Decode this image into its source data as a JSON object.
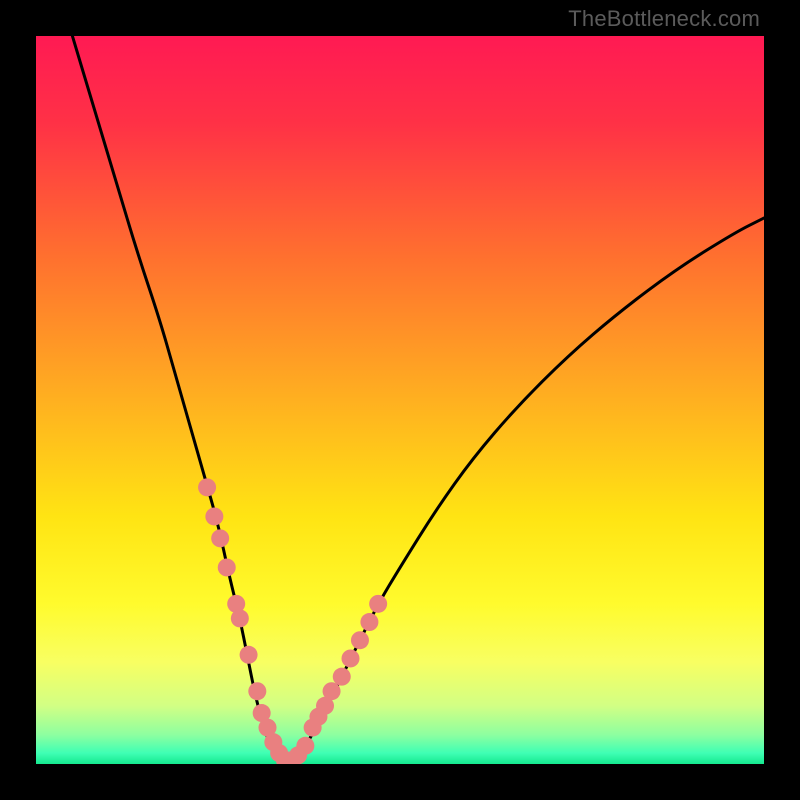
{
  "watermark": "TheBottleneck.com",
  "chart_data": {
    "type": "line",
    "title": "",
    "xlabel": "",
    "ylabel": "",
    "xlim": [
      0,
      100
    ],
    "ylim": [
      0,
      100
    ],
    "background_gradient_stops": [
      {
        "offset": 0.0,
        "color": "#ff1a53"
      },
      {
        "offset": 0.12,
        "color": "#ff3146"
      },
      {
        "offset": 0.3,
        "color": "#ff6f2f"
      },
      {
        "offset": 0.5,
        "color": "#ffb020"
      },
      {
        "offset": 0.66,
        "color": "#ffe413"
      },
      {
        "offset": 0.78,
        "color": "#fffb2d"
      },
      {
        "offset": 0.86,
        "color": "#f8ff62"
      },
      {
        "offset": 0.92,
        "color": "#d2ff84"
      },
      {
        "offset": 0.96,
        "color": "#8dffa0"
      },
      {
        "offset": 0.985,
        "color": "#3fffb4"
      },
      {
        "offset": 1.0,
        "color": "#15e98f"
      }
    ],
    "series": [
      {
        "name": "bottleneck-curve",
        "type": "line",
        "color": "#000000",
        "width": 3,
        "x": [
          5,
          8,
          11,
          14,
          17,
          19,
          21,
          23,
          25,
          26.5,
          28,
          29,
          30,
          31,
          32,
          33,
          34,
          35,
          36,
          37,
          38.5,
          40,
          42,
          44,
          47,
          50,
          55,
          60,
          66,
          73,
          80,
          88,
          96,
          100
        ],
        "y": [
          100,
          90,
          80,
          70,
          61,
          54,
          47,
          40,
          33,
          26,
          20,
          15,
          10,
          6,
          3,
          1,
          0,
          0,
          1,
          2.5,
          5,
          8,
          12,
          16,
          22,
          27,
          35,
          42,
          49,
          56,
          62,
          68,
          73,
          75
        ]
      },
      {
        "name": "highlight-dots-left",
        "type": "scatter",
        "color": "#e98080",
        "radius": 9,
        "x": [
          23.5,
          24.5,
          25.3,
          26.2,
          27.5,
          28.0,
          29.2,
          30.4,
          31.0,
          31.8,
          32.6,
          33.4
        ],
        "y": [
          38,
          34,
          31,
          27,
          22,
          20,
          15,
          10,
          7,
          5,
          3,
          1.5
        ]
      },
      {
        "name": "highlight-dots-right",
        "type": "scatter",
        "color": "#e98080",
        "radius": 9,
        "x": [
          34.2,
          35.0,
          36.0,
          37.0,
          38.0,
          38.8,
          39.7,
          40.6,
          42.0,
          43.2,
          44.5,
          45.8,
          47.0
        ],
        "y": [
          0.5,
          0.5,
          1.2,
          2.5,
          5,
          6.5,
          8,
          10,
          12,
          14.5,
          17,
          19.5,
          22
        ]
      }
    ]
  }
}
